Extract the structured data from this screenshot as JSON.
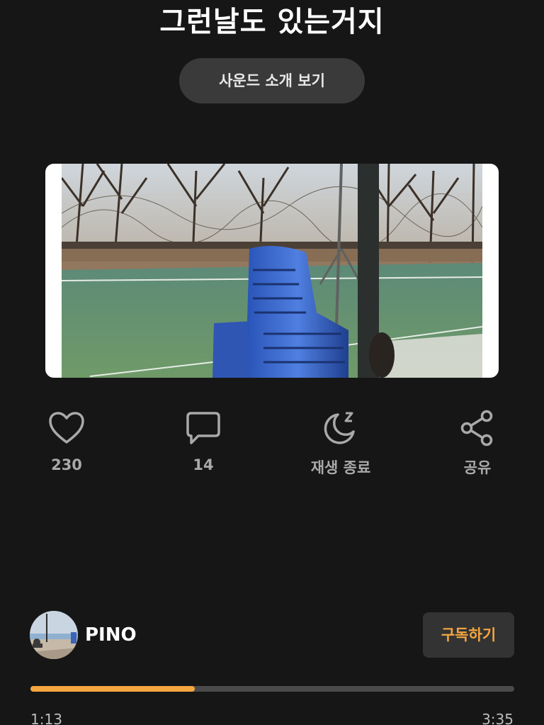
{
  "track": {
    "title": "그런날도 있는거지"
  },
  "intro_button": {
    "label": "사운드 소개 보기"
  },
  "actions": [
    {
      "icon": "heart-icon",
      "label": "230"
    },
    {
      "icon": "comment-icon",
      "label": "14"
    },
    {
      "icon": "sleep-timer-icon",
      "label": "재생 종료"
    },
    {
      "icon": "share-icon",
      "label": "공유"
    }
  ],
  "creator": {
    "name": "PINO",
    "subscribe_label": "구독하기"
  },
  "player": {
    "elapsed": "1:13",
    "total": "3:35",
    "progress": 0.34
  },
  "colors": {
    "accent": "#f5a63f",
    "background": "#161616",
    "icon": "#a9a9a9"
  }
}
